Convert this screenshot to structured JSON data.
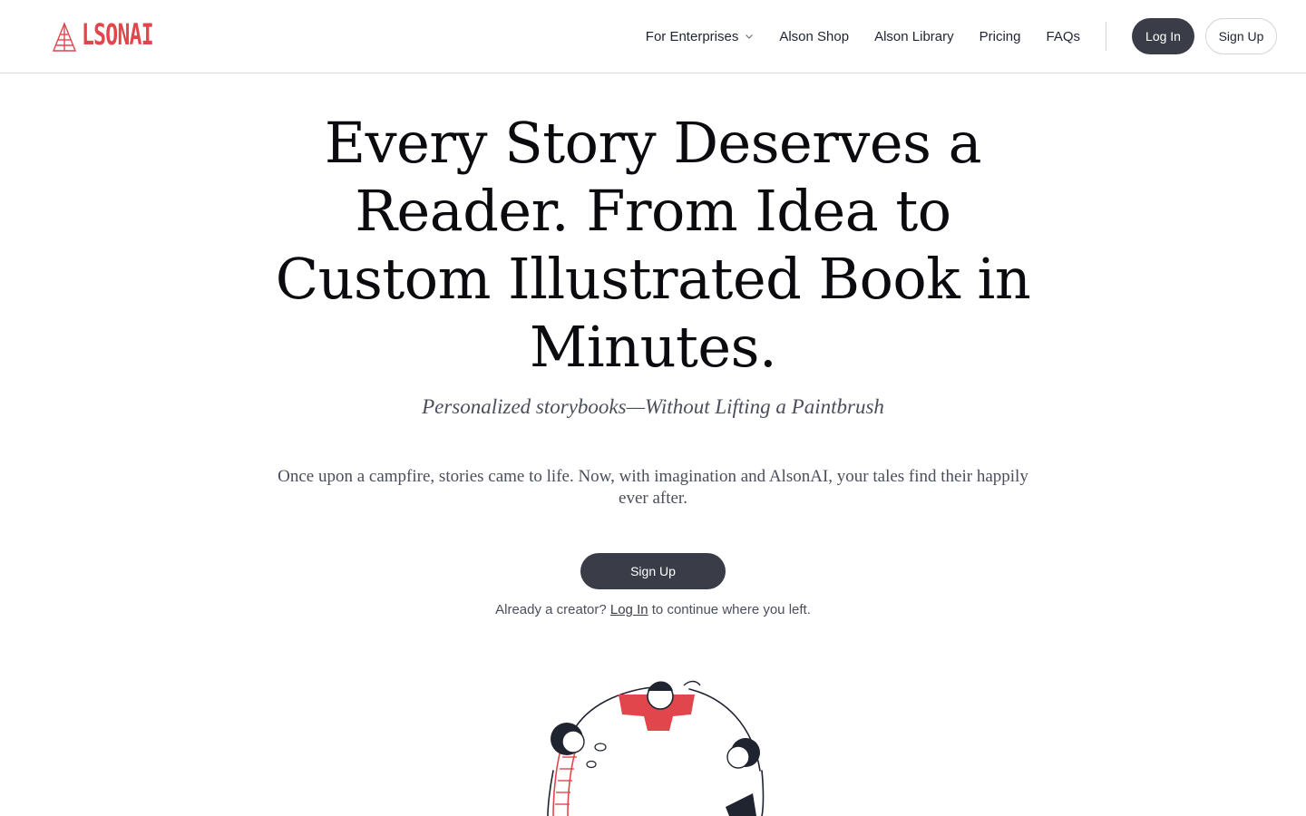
{
  "brand": {
    "name": "LSONAI",
    "accent_color": "#e0464c",
    "logo_icon": "campfire-tent-icon"
  },
  "nav": {
    "items": [
      {
        "label": "For Enterprises",
        "has_dropdown": true
      },
      {
        "label": "Alson Shop"
      },
      {
        "label": "Alson Library"
      },
      {
        "label": "Pricing"
      },
      {
        "label": "FAQs"
      }
    ],
    "login_label": "Log In",
    "signup_label": "Sign Up"
  },
  "hero": {
    "title": "Every Story Deserves a Reader. From Idea to Custom Illustrated Book in Minutes.",
    "subtitle": "Personalized storybooks—Without Lifting a Paintbrush",
    "body": "Once upon a campfire, stories came to life. Now, with imagination and AlsonAI, your tales find their happily ever after.",
    "cta_label": "Sign Up",
    "note_prefix": "Already a creator?",
    "note_link": "Log In",
    "note_suffix": "to continue where you left."
  },
  "colors": {
    "primary_button": "#3a3d48",
    "text_dark": "#0b0b0f",
    "text_muted": "#4b4f5c"
  }
}
